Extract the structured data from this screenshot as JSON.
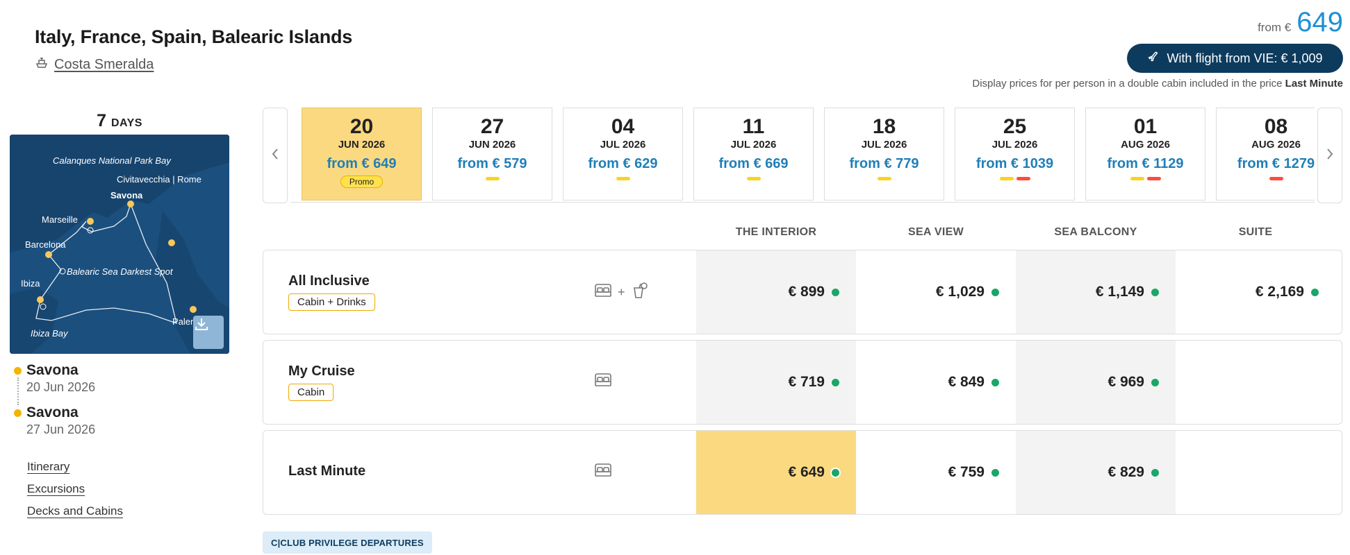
{
  "header": {
    "title": "Italy, France, Spain, Balearic Islands",
    "ship": "Costa Smeralda",
    "from_label": "from €",
    "from_price": "649",
    "flight_button": "With flight from VIE: € 1,009",
    "note_prefix": "Display prices for per person in a double cabin included in the price",
    "note_bold": "Last Minute"
  },
  "left": {
    "days_num": "7",
    "days_label": "DAYS",
    "map_labels": [
      "Calanques National Park Bay",
      "Civitavecchia | Rome",
      "Savona",
      "Marseille",
      "Barcelona",
      "Balearic Sea Darkest Spot",
      "Ibiza",
      "Palermo",
      "Ibiza Bay"
    ],
    "departure": {
      "port": "Savona",
      "date": "20 Jun 2026"
    },
    "arrival": {
      "port": "Savona",
      "date": "27 Jun 2026"
    },
    "links": [
      "Itinerary",
      "Excursions",
      "Decks and Cabins"
    ]
  },
  "dates": [
    {
      "day": "20",
      "month": "JUN 2026",
      "price": "from € 649",
      "badge": "Promo",
      "bars": []
    },
    {
      "day": "27",
      "month": "JUN 2026",
      "price": "from € 579",
      "bars": [
        "yellow"
      ]
    },
    {
      "day": "04",
      "month": "JUL 2026",
      "price": "from € 629",
      "bars": [
        "yellow"
      ]
    },
    {
      "day": "11",
      "month": "JUL 2026",
      "price": "from € 669",
      "bars": [
        "yellow"
      ]
    },
    {
      "day": "18",
      "month": "JUL 2026",
      "price": "from € 779",
      "bars": [
        "yellow"
      ]
    },
    {
      "day": "25",
      "month": "JUL 2026",
      "price": "from € 1039",
      "bars": [
        "yellow",
        "red"
      ]
    },
    {
      "day": "01",
      "month": "AUG 2026",
      "price": "from € 1129",
      "bars": [
        "yellow",
        "red"
      ]
    },
    {
      "day": "08",
      "month": "AUG 2026",
      "price": "from € 1279",
      "bars": [
        "red"
      ]
    }
  ],
  "cabin_columns": [
    "THE INTERIOR",
    "SEA VIEW",
    "SEA BALCONY",
    "SUITE"
  ],
  "fares": [
    {
      "name": "All Inclusive",
      "tag": "Cabin + Drinks",
      "icons": [
        "bed-icon",
        "drink-icon"
      ],
      "prices": [
        "€ 899",
        "€ 1,029",
        "€ 1,149",
        "€ 2,169"
      ]
    },
    {
      "name": "My Cruise",
      "tag": "Cabin",
      "icons": [
        "bed-icon"
      ],
      "prices": [
        "€ 719",
        "€ 849",
        "€ 969"
      ]
    },
    {
      "name": "Last Minute",
      "tag": "",
      "icons": [
        "bed-icon"
      ],
      "prices": [
        "€ 649",
        "€ 759",
        "€ 829"
      ]
    }
  ],
  "club_badge": "C|CLUB PRIVILEGE DEPARTURES",
  "colors": {
    "accent": "#1e90d6",
    "navy": "#0d3b5e",
    "highlight": "#fbd980",
    "available": "#1aa668",
    "tag_border": "#f0a800"
  }
}
